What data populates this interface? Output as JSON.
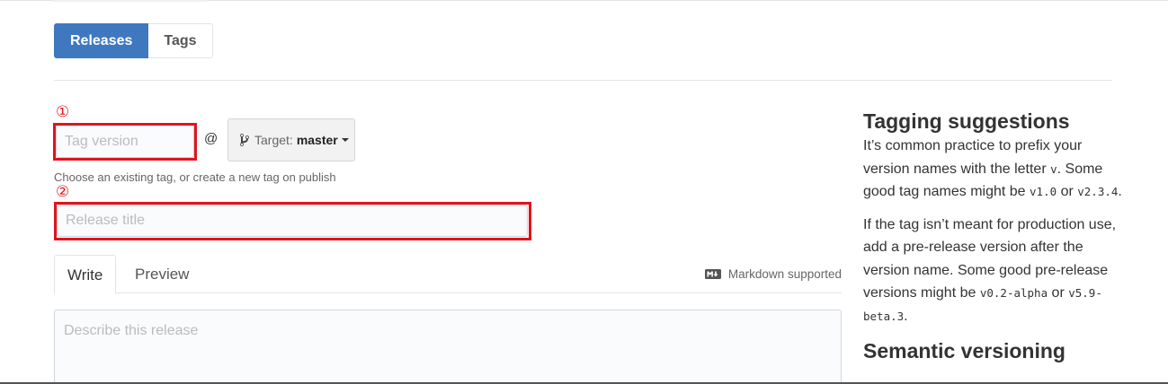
{
  "subnav": {
    "releases_label": "Releases",
    "tags_label": "Tags"
  },
  "annotations": {
    "marker_1": "①",
    "marker_2": "②"
  },
  "tag_field": {
    "placeholder": "Tag version",
    "value": ""
  },
  "at_sign": "@",
  "target": {
    "label": "Target:",
    "branch": "master"
  },
  "tag_hint": "Choose an existing tag, or create a new tag on publish",
  "title_field": {
    "placeholder": "Release title",
    "value": ""
  },
  "editor_tabs": {
    "write": "Write",
    "preview": "Preview",
    "markdown_note": "Markdown supported"
  },
  "description": {
    "placeholder": "Describe this release",
    "value": ""
  },
  "sidebar": {
    "heading1": "Tagging suggestions",
    "p1": {
      "t1": "It’s common practice to prefix your version names with the letter ",
      "c1": "v",
      "t2": ". Some good tag names might be ",
      "c2": "v1.0",
      "t3": " or ",
      "c3": "v2.3.4",
      "t4": "."
    },
    "p2": {
      "t1": "If the tag isn’t meant for production use, add a pre-release version after the version name. Some good pre-release versions might be ",
      "c1": "v0.2-alpha",
      "t2": " or ",
      "c2": "v5.9-beta.3",
      "t3": "."
    },
    "heading2": "Semantic versioning"
  },
  "colors": {
    "accent": "#4078c0",
    "annotation_red": "#e0141e"
  },
  "icons": [
    "git-branch-icon",
    "caret-down-icon",
    "markdown-icon"
  ]
}
